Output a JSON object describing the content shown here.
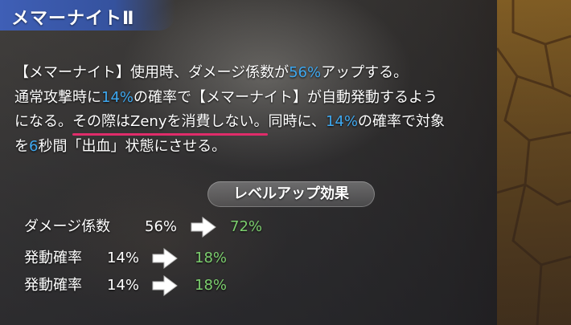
{
  "skill": {
    "title": "メマーナイトⅡ"
  },
  "description": {
    "l1_a": "【メマーナイト】使用時、ダメージ係数が",
    "l1_b": "56%",
    "l1_c": "アップする。",
    "l2_a": "通常攻撃時に",
    "l2_b": "14%",
    "l2_c": "の確率で【メマーナイト】が自動発動するよう",
    "l3_a": "になる。",
    "l3_b": "その際はZenyを消費しない。",
    "l3_c": "同時に、",
    "l3_d": "14%",
    "l3_e": "の確率で対象",
    "l4_a": "を",
    "l4_b": "6",
    "l4_c": "秒間「出血」状態にさせる。"
  },
  "levelup": {
    "heading": "レベルアップ効果",
    "rows": [
      {
        "label": "ダメージ係数",
        "current": "56%",
        "next": "72%"
      },
      {
        "label": "発動確率",
        "current": "14%",
        "next": "18%"
      },
      {
        "label": "発動確率",
        "current": "14%",
        "next": "18%"
      }
    ]
  },
  "colors": {
    "highlight": "#3ea8f0",
    "underline": "#e02c6a",
    "next_value": "#7ccf6e",
    "header": "#3f5fb6"
  },
  "icons": {
    "arrow": "arrow-right-icon"
  }
}
